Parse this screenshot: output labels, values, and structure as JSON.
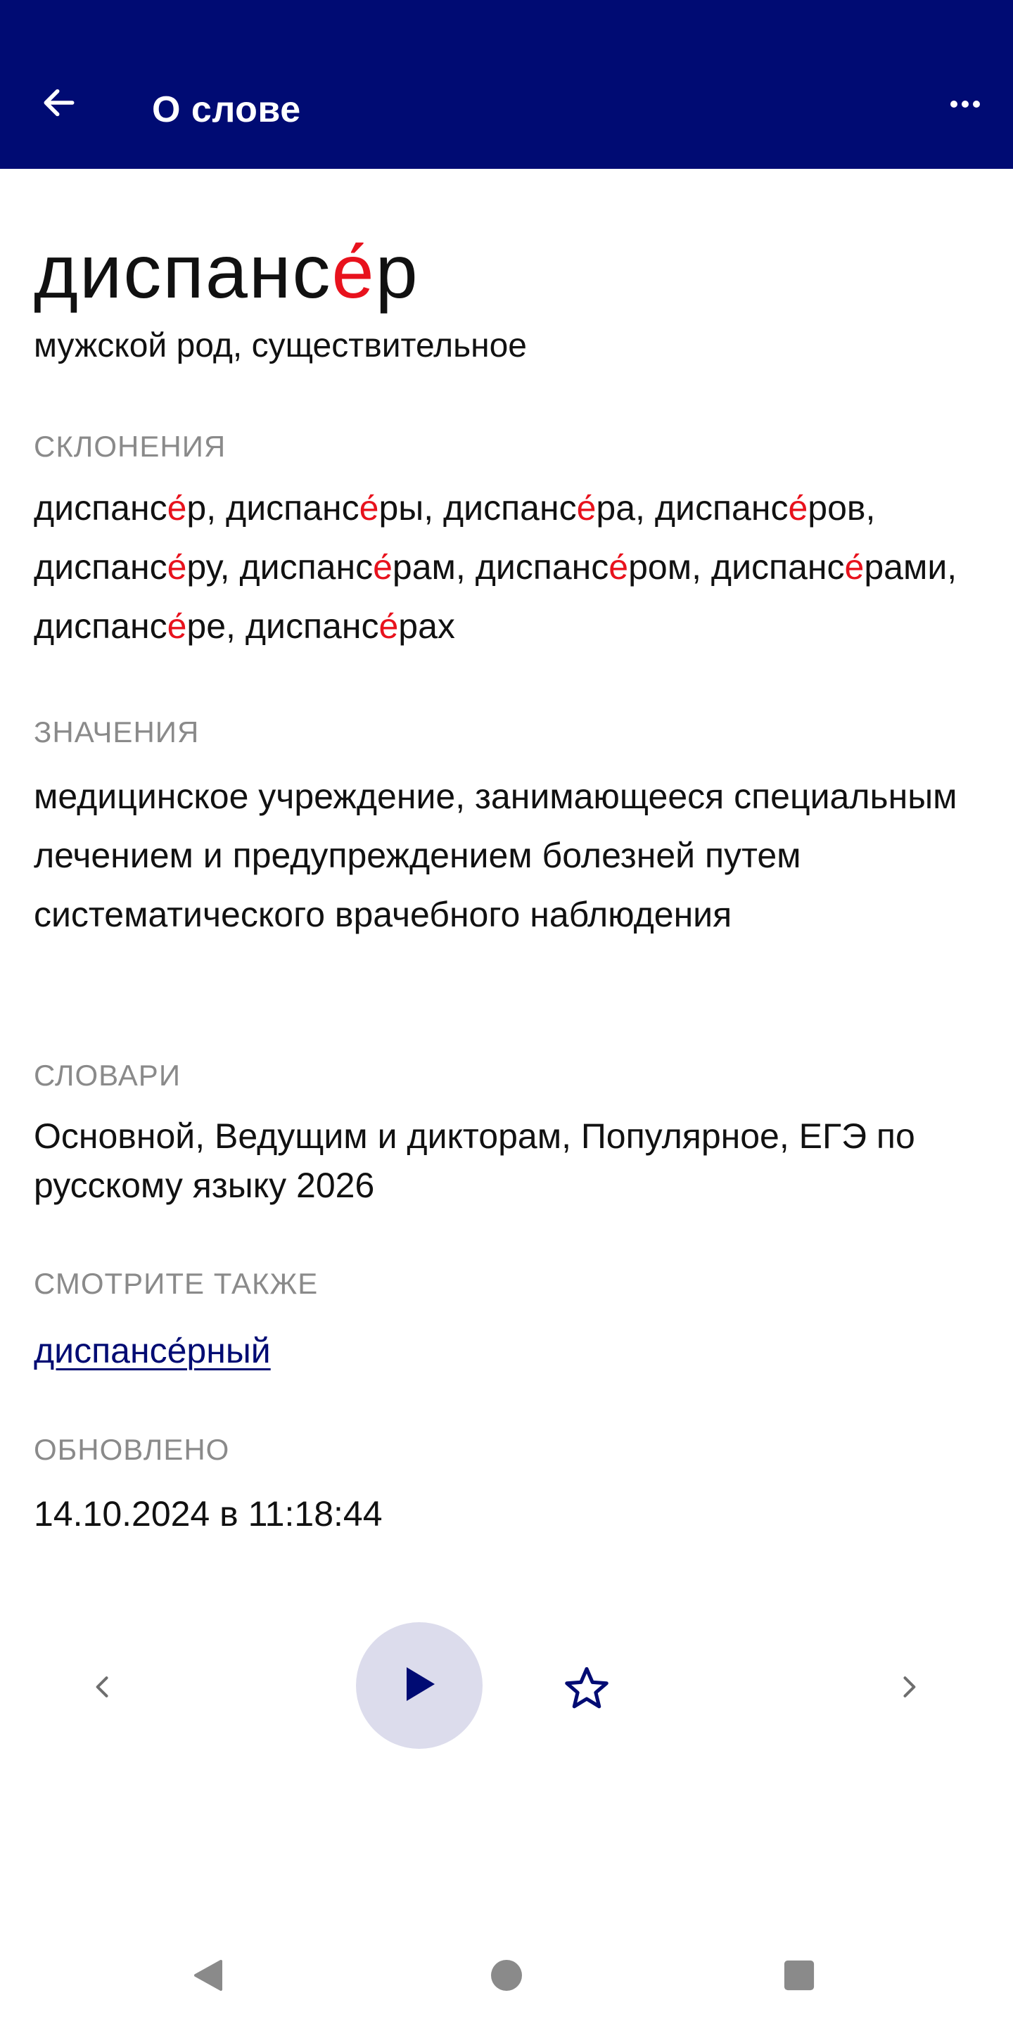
{
  "appbar": {
    "title": "О слове",
    "back_icon": "arrow-left-icon",
    "more_icon": "more-horizontal-icon",
    "background": "#000b73"
  },
  "word": {
    "before_stress": "диспанс",
    "stressed": "е́",
    "after_stress": "р",
    "part_of_speech": "мужской род, существительное"
  },
  "sections": {
    "declensions_label": "СКЛОНЕНИЯ",
    "declensions": [
      {
        "pre": "диспанс",
        "stress": "е́",
        "post": "р",
        "sep": ", "
      },
      {
        "pre": "диспанс",
        "stress": "е́",
        "post": "ры",
        "sep": ", "
      },
      {
        "pre": "диспанс",
        "stress": "е́",
        "post": "ра",
        "sep": ", "
      },
      {
        "pre": "диспанс",
        "stress": "е́",
        "post": "ров",
        "sep": ", "
      },
      {
        "pre": "диспанс",
        "stress": "е́",
        "post": "ру",
        "sep": ", "
      },
      {
        "pre": "диспанс",
        "stress": "е́",
        "post": "рам",
        "sep": ", "
      },
      {
        "pre": "диспанс",
        "stress": "е́",
        "post": "ром",
        "sep": ", "
      },
      {
        "pre": "диспанс",
        "stress": "е́",
        "post": "рами",
        "sep": ", "
      },
      {
        "pre": "диспанс",
        "stress": "е́",
        "post": "ре",
        "sep": ", "
      },
      {
        "pre": "диспанс",
        "stress": "е́",
        "post": "рах",
        "sep": ""
      }
    ],
    "meanings_label": "ЗНАЧЕНИЯ",
    "meaning": "медицинское учреждение, занимающееся специальным лечением и предупреждением болезней путем систематического врачебного наблюдения",
    "dictionaries_label": "СЛОВАРИ",
    "dictionaries": "Основной, Ведущим и дикторам, Популярное, ЕГЭ по русскому языку 2026",
    "see_also_label": "СМОТРИТЕ ТАКЖЕ",
    "see_also": "диспансе́рный",
    "updated_label": "ОБНОВЛЕНО",
    "updated": "14.10.2024 в 11:18:44"
  },
  "player": {
    "prev_icon": "chevron-left-icon",
    "play_icon": "play-icon",
    "favorite_icon": "star-outline-icon",
    "next_icon": "chevron-right-icon"
  },
  "system_nav": {
    "back_icon": "triangle-back-icon",
    "home_icon": "circle-home-icon",
    "recents_icon": "square-recents-icon"
  },
  "colors": {
    "accent": "#000b73",
    "stress": "#e8121d",
    "label": "#8a8a8a",
    "play_bg": "#dcdcec"
  }
}
